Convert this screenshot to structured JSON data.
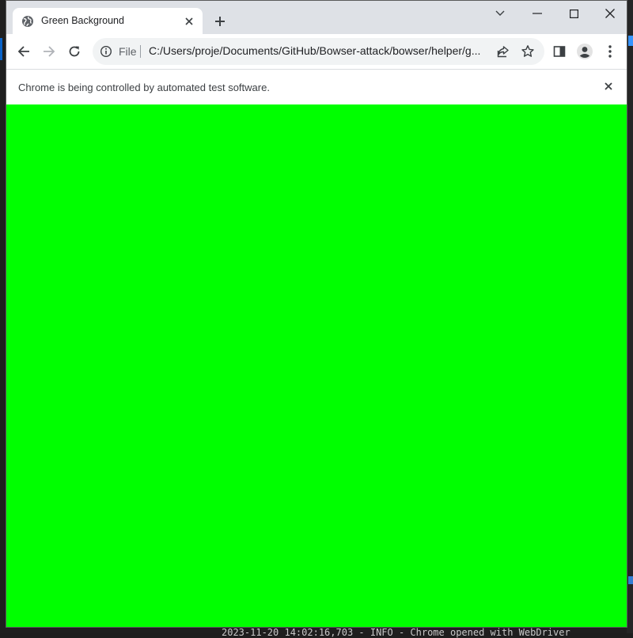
{
  "browser": {
    "tab": {
      "title": "Green Background",
      "icon": "globe-icon"
    },
    "address_bar": {
      "scheme_label": "File",
      "url": "C:/Users/proje/Documents/GitHub/Bowser-attack/bowser/helper/g..."
    },
    "infobar": {
      "message": "Chrome is being controlled by automated test software."
    },
    "page": {
      "background_color": "#00ff00"
    }
  },
  "background_terminal": {
    "log_line": "2023-11-20 14:02:16,703 - INFO - Chrome opened with WebDriver"
  }
}
